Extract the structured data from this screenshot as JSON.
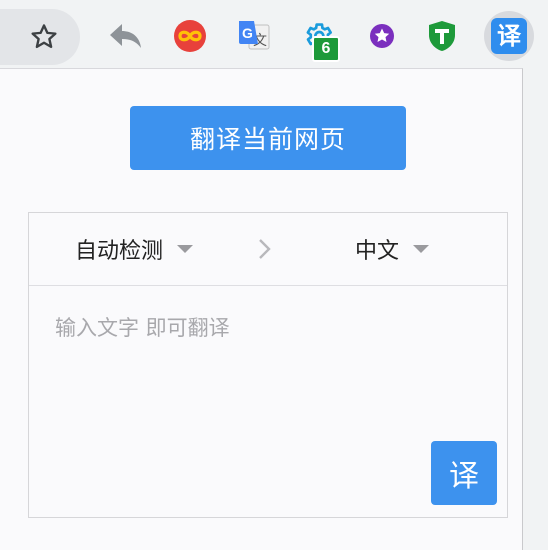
{
  "toolbar": {
    "icons": [
      {
        "name": "bookmark-star-icon"
      },
      {
        "name": "reply-arrow-icon"
      },
      {
        "name": "infinity-extension-icon",
        "color": "#e53935"
      },
      {
        "name": "google-translate-icon",
        "color": "#4285f4"
      },
      {
        "name": "gear-extension-icon",
        "color": "#1a9bdc",
        "badge": "6"
      },
      {
        "name": "purple-star-icon",
        "color": "#7b2fbe"
      },
      {
        "name": "green-shield-icon",
        "color": "#1e9a3a"
      },
      {
        "name": "translate-extension-icon",
        "label": "译",
        "color": "#2f8dee"
      }
    ]
  },
  "popup": {
    "translate_page_label": "翻译当前网页",
    "source_language": "自动检测",
    "target_language": "中文",
    "input": {
      "value": "",
      "placeholder": "输入文字 即可翻译"
    },
    "translate_button_label": "译",
    "accent_color": "#3d92ee"
  }
}
